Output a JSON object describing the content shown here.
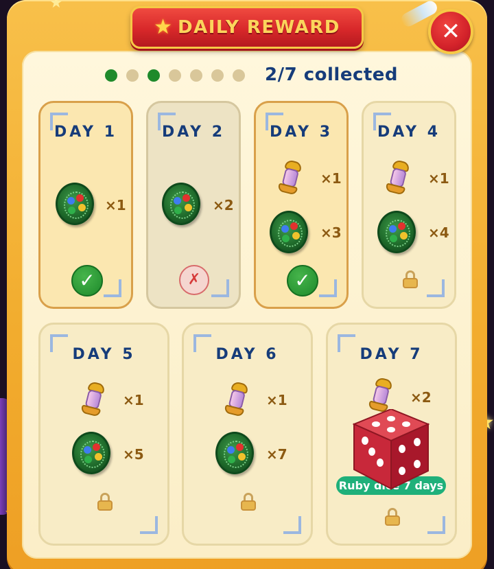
{
  "header": {
    "title": "DAILY REWARD",
    "title_icon": "star-icon",
    "close_icon": "close-icon"
  },
  "progress": {
    "claimed": 2,
    "total": 7,
    "text": "2/7 collected",
    "dots": [
      true,
      false,
      true,
      false,
      false,
      false,
      false
    ]
  },
  "colors": {
    "accent_red": "#d8282a",
    "frame_gold": "#f2ad2f",
    "check_green": "#1e8a2b",
    "text_blue": "#163c7a",
    "badge_green": "#1fb07a"
  },
  "days": [
    {
      "label": "DAY 1",
      "status": "claimed",
      "rewards": [
        {
          "item": "green-disc",
          "qty": "×1"
        }
      ]
    },
    {
      "label": "DAY 2",
      "status": "missed",
      "rewards": [
        {
          "item": "green-disc",
          "qty": "×2"
        }
      ]
    },
    {
      "label": "DAY 3",
      "status": "claimed",
      "rewards": [
        {
          "item": "lantern",
          "qty": "×1"
        },
        {
          "item": "green-disc",
          "qty": "×3"
        }
      ]
    },
    {
      "label": "DAY 4",
      "status": "locked",
      "rewards": [
        {
          "item": "lantern",
          "qty": "×1"
        },
        {
          "item": "green-disc",
          "qty": "×4"
        }
      ]
    },
    {
      "label": "DAY 5",
      "status": "locked",
      "rewards": [
        {
          "item": "lantern",
          "qty": "×1"
        },
        {
          "item": "green-disc",
          "qty": "×5"
        }
      ]
    },
    {
      "label": "DAY 6",
      "status": "locked",
      "rewards": [
        {
          "item": "lantern",
          "qty": "×1"
        },
        {
          "item": "green-disc",
          "qty": "×7"
        }
      ]
    },
    {
      "label": "DAY 7",
      "status": "locked",
      "rewards": [
        {
          "item": "lantern",
          "qty": "×2"
        },
        {
          "item": "ruby-dice",
          "qty": ""
        }
      ],
      "badge": "Ruby dice 7 days"
    }
  ],
  "status_marks": {
    "claimed": "✓",
    "missed": "✗"
  }
}
